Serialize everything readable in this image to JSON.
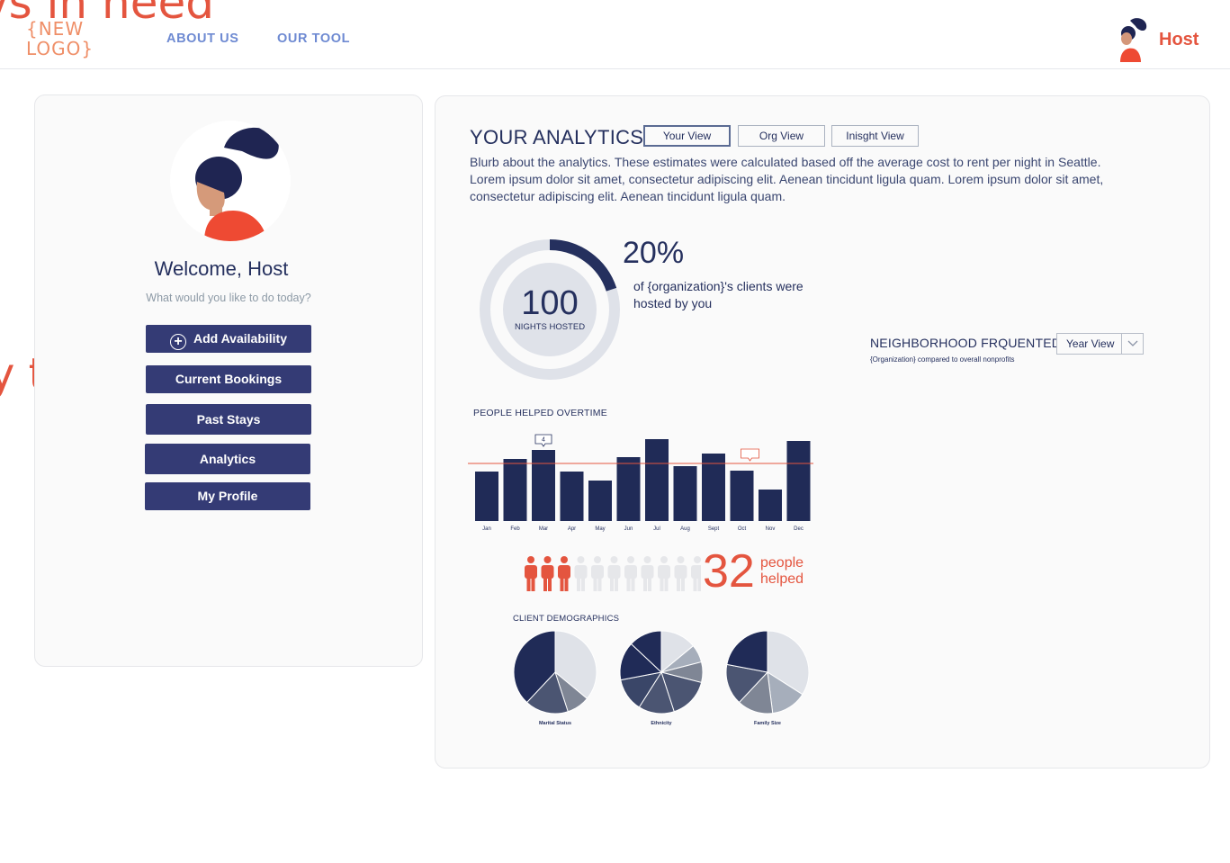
{
  "background": {
    "top_text": "vs in need",
    "side_text": "y times"
  },
  "header": {
    "logo": "{NEW LOGO}",
    "nav": [
      "ABOUT US",
      "OUR TOOL"
    ],
    "user_name": "Host"
  },
  "profile": {
    "welcome": "Welcome, Host",
    "subtitle": "What would you like to do today?",
    "menu": [
      {
        "label": "Add Availability",
        "icon": "plus-circle-icon"
      },
      {
        "label": "Current Bookings"
      },
      {
        "label": "Past Stays"
      },
      {
        "label": "Analytics"
      },
      {
        "label": "My Profile"
      }
    ]
  },
  "analytics": {
    "title": "YOUR ANALYTICS",
    "views": [
      "Your View",
      "Org View",
      "Insight View"
    ],
    "views_display": [
      "Your View",
      "Org View",
      "Inisght View"
    ],
    "active_view": "Your View",
    "blurb": "Blurb about the analytics. These estimates were calculated based off the average cost to rent per night in Seattle. Lorem ipsum dolor sit amet, consectetur adipiscing elit. Aenean tincidunt ligula quam. Lorem ipsum dolor sit amet, consectetur adipiscing elit. Aenean tincidunt ligula quam.",
    "nights": {
      "value": "100",
      "label": "NIGHTS HOSTED",
      "fraction": 0.2
    },
    "percent": {
      "value": "20%",
      "text": "of {organization}'s clients were hosted by you"
    },
    "neighborhood": {
      "title": "NEIGHBORHOOD FRQUENTED",
      "subtitle": "{Organization} compared to overall nonprofits",
      "select_value": "Year View"
    },
    "people_helped": {
      "count": "32",
      "label_line1": "people",
      "label_line2": "helped",
      "filled": 3,
      "total": 11
    },
    "demographics_title": "CLIENT DEMOGRAPHICS"
  },
  "colors": {
    "navy": "#25305e",
    "accent": "#e4553f",
    "button": "#343b75",
    "nav": "#6e8ad2"
  },
  "chart_data": [
    {
      "type": "bar",
      "title": "PEOPLE HELPED OVERTIME",
      "categories": [
        "Jan",
        "Feb",
        "Mar",
        "Apr",
        "May",
        "Jun",
        "Jul",
        "Aug",
        "Sept",
        "Oct",
        "Nov",
        "Dec"
      ],
      "values": [
        55,
        69,
        79,
        55,
        45,
        71,
        91,
        61,
        75,
        56,
        35,
        89
      ],
      "reference_line": 64,
      "ylim": [
        0,
        100
      ],
      "annotations": [
        {
          "category": "Mar",
          "text": "4"
        }
      ]
    },
    {
      "type": "pie",
      "title": "Marital Status",
      "values": [
        36,
        9,
        17,
        38
      ],
      "colors": [
        "#dfe2e8",
        "#7f8695",
        "#4b5572",
        "#202b57"
      ]
    },
    {
      "type": "pie",
      "title": "Ethnicity",
      "values": [
        14,
        7,
        8,
        16,
        14,
        13,
        15,
        13
      ],
      "colors": [
        "#dfe2e8",
        "#a6aebb",
        "#7f8695",
        "#4b5572",
        "#4b5572",
        "#3a4668",
        "#202b57",
        "#202b57"
      ]
    },
    {
      "type": "pie",
      "title": "Family Size",
      "values": [
        34,
        14,
        14,
        16,
        22
      ],
      "colors": [
        "#dfe2e8",
        "#a6aebb",
        "#7f8695",
        "#4b5572",
        "#202b57"
      ]
    }
  ]
}
